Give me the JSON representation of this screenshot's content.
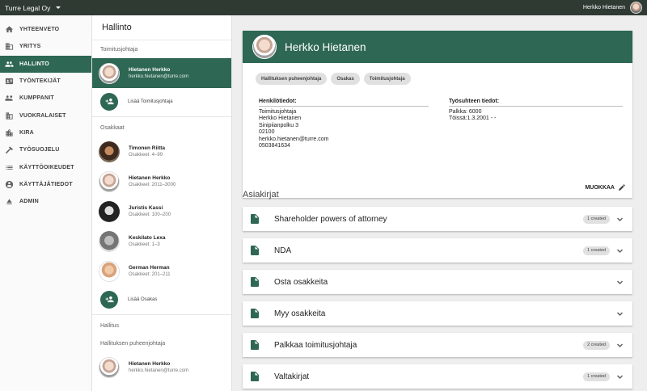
{
  "topbar": {
    "company": "Turre Legal Oy",
    "user_name": "Herkko Hietanen"
  },
  "nav": {
    "items": [
      {
        "label": "YHTEENVETO",
        "icon": "home-icon"
      },
      {
        "label": "YRITYS",
        "icon": "building-icon"
      },
      {
        "label": "HALLINTO",
        "icon": "people-icon",
        "active": true
      },
      {
        "label": "TYÖNTEKIJÄT",
        "icon": "badge-icon"
      },
      {
        "label": "KUMPPANIT",
        "icon": "partners-icon"
      },
      {
        "label": "VUOKRALAISET",
        "icon": "business-icon"
      },
      {
        "label": "KIRA",
        "icon": "city-icon"
      },
      {
        "label": "TYÖSUOJELU",
        "icon": "hammer-icon"
      },
      {
        "label": "KÄYTTÖOIKEUDET",
        "icon": "list-icon"
      },
      {
        "label": "KÄYTTÄJÄTIEDOT",
        "icon": "account-icon"
      },
      {
        "label": "ADMIN",
        "icon": "eject-icon"
      }
    ]
  },
  "mid": {
    "title": "Hallinto",
    "ceo_label": "Toimitusjohtaja",
    "ceo": {
      "name": "Hietanen Herkko",
      "sub": "herkko.hietanen@turre.com"
    },
    "add_ceo": "Lisää Toimitusjohtaja",
    "owners_label": "Osakkaat",
    "owners": [
      {
        "name": "Timonen Riitta",
        "sub": "Osakkeet: 4–99"
      },
      {
        "name": "Hietanen Herkko",
        "sub": "Osakkeet: 2011–3000"
      },
      {
        "name": "Juristis Kassi",
        "sub": "Osakkeet: 100–200"
      },
      {
        "name": "Keskilato Lexa",
        "sub": "Osakkeet: 1–3"
      },
      {
        "name": "German Herman",
        "sub": "Osakkeet: 201–211"
      }
    ],
    "add_owner": "Lisää Osakas",
    "board_label": "Hallitus",
    "chair_label": "Hallituksen puheenjohtaja",
    "chair": {
      "name": "Hietanen Herkko",
      "sub": "herkko.hietanen@turre.com"
    }
  },
  "card": {
    "name": "Herkko Hietanen",
    "chips": [
      "Hallituksen puheenjohtaja",
      "Osakas",
      "Toimitusjohtaja"
    ],
    "personal_title": "Henkilötiedot:",
    "personal_lines": [
      "Toimitusjohtaja",
      "Herkko Hietanen",
      "Sinipiianpolku 3",
      "02100",
      "herkko.hietanen@turre.com",
      "0503841634"
    ],
    "employment_title": "Työsuhteen tiedot:",
    "employment_lines": [
      "Palkka: 6000",
      "Töissä:1.3.2001 - -"
    ],
    "edit_label": "MUOKKAA"
  },
  "docs": {
    "title": "Asiakirjat",
    "items": [
      {
        "name": "Shareholder powers of attorney",
        "badge": "1 created"
      },
      {
        "name": "NDA",
        "badge": "1 created"
      },
      {
        "name": "Osta osakkeita",
        "badge": ""
      },
      {
        "name": "Myy osakkeita",
        "badge": ""
      },
      {
        "name": "Palkkaa toimitusjohtaja",
        "badge": "2 created"
      },
      {
        "name": "Valtakirjat",
        "badge": "1 created"
      }
    ]
  },
  "colors": {
    "primary": "#2e6754",
    "topbar": "#2f3a33"
  }
}
